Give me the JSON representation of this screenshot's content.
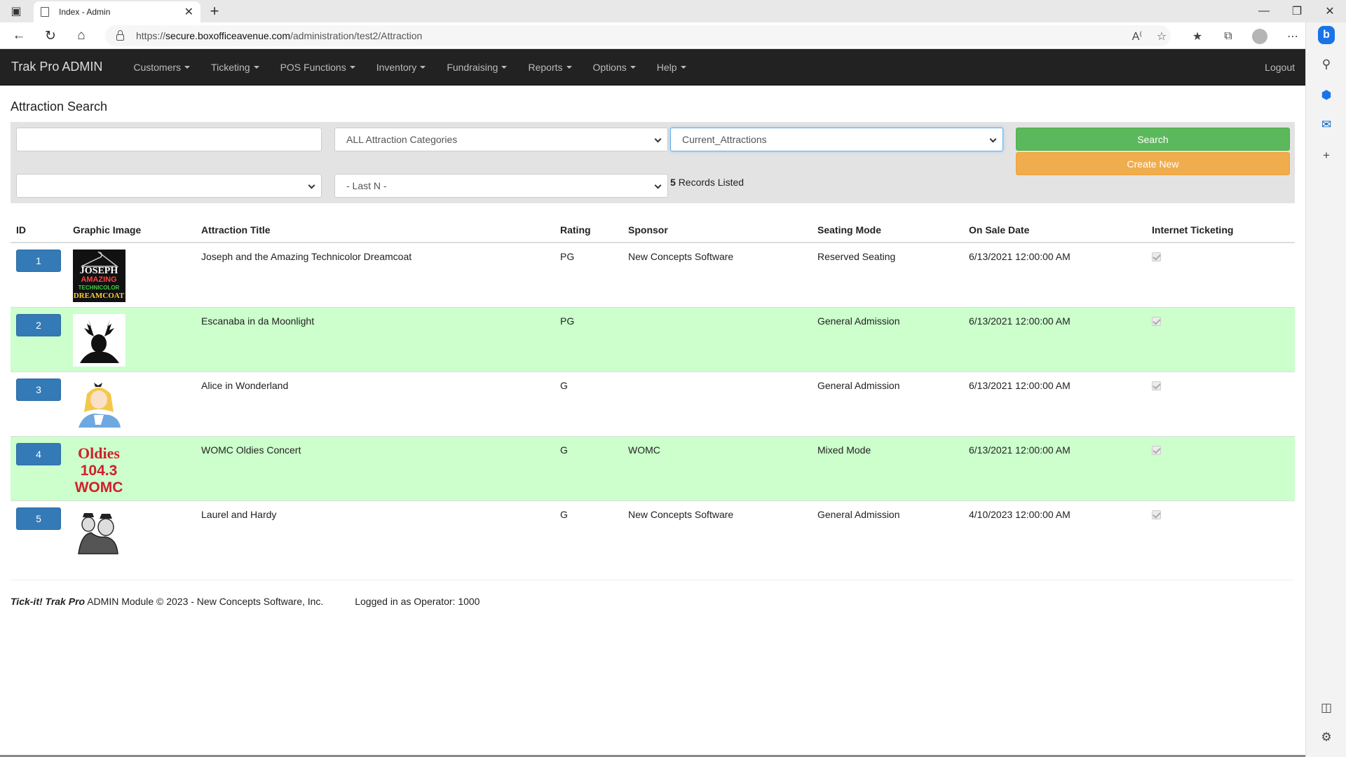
{
  "browser": {
    "tab_title": "Index - Admin",
    "url_prefix": "https://",
    "url_host": "secure.boxofficeavenue.com",
    "url_path": "/administration/test2/Attraction"
  },
  "nav": {
    "brand": "Trak Pro ADMIN",
    "menu": [
      "Customers",
      "Ticketing",
      "POS Functions",
      "Inventory",
      "Fundraising",
      "Reports",
      "Options",
      "Help"
    ],
    "logout": "Logout"
  },
  "page": {
    "title": "Attraction Search"
  },
  "search": {
    "keyword_value": "",
    "category_selected": "ALL Attraction Categories",
    "status_selected": "Current_Attractions",
    "filter3_selected": "",
    "lastn_selected": "- Last N -",
    "search_label": "Search",
    "create_label": "Create New",
    "records_count": "5",
    "records_text": "Records Listed"
  },
  "table": {
    "headers": [
      "ID",
      "Graphic Image",
      "Attraction Title",
      "Rating",
      "Sponsor",
      "Seating Mode",
      "On Sale Date",
      "Internet Ticketing"
    ],
    "rows": [
      {
        "id": "1",
        "image": "joseph-logo",
        "title": "Joseph and the Amazing Technicolor Dreamcoat",
        "rating": "PG",
        "sponsor": "New Concepts Software",
        "seating": "Reserved Seating",
        "on_sale": "6/13/2021 12:00:00 AM",
        "internet": true
      },
      {
        "id": "2",
        "image": "moose-silhouette",
        "title": "Escanaba in da Moonlight",
        "rating": "PG",
        "sponsor": "",
        "seating": "General Admission",
        "on_sale": "6/13/2021 12:00:00 AM",
        "internet": true
      },
      {
        "id": "3",
        "image": "alice-illustration",
        "title": "Alice in Wonderland",
        "rating": "G",
        "sponsor": "",
        "seating": "General Admission",
        "on_sale": "6/13/2021 12:00:00 AM",
        "internet": true
      },
      {
        "id": "4",
        "image": "womc-logo",
        "title": "WOMC Oldies Concert",
        "rating": "G",
        "sponsor": "WOMC",
        "seating": "Mixed Mode",
        "on_sale": "6/13/2021 12:00:00 AM",
        "internet": true
      },
      {
        "id": "5",
        "image": "laurel-hardy-sketch",
        "title": "Laurel and Hardy",
        "rating": "G",
        "sponsor": "New Concepts Software",
        "seating": "General Admission",
        "on_sale": "4/10/2023 12:00:00 AM",
        "internet": true
      }
    ]
  },
  "footer": {
    "brandmark": "Tick-it! Trak Pro",
    "module_text": "ADMIN Module © 2023 - New Concepts Software, Inc.",
    "operator_text": "Logged in as Operator: 1000"
  },
  "colors": {
    "navbar": "#222222",
    "alt_row": "#ccffcc",
    "id_button": "#337ab7",
    "search_button": "#5cb85c",
    "create_button": "#f0ad4e"
  },
  "joseph_logo_text": [
    "JOSEPH",
    "AMAZING",
    "TECHNICOLOR",
    "DREAMCOAT"
  ],
  "womc_logo_text": [
    "Oldies",
    "104.3",
    "WOMC"
  ]
}
